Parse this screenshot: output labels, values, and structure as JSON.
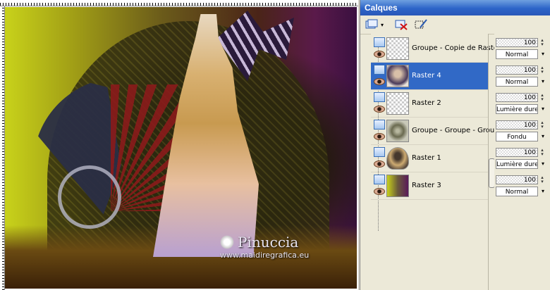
{
  "palette": {
    "title": "Calques"
  },
  "watermark": {
    "signature": "Pinuccia",
    "url": "www.maidiregrafica.eu"
  },
  "layers": [
    {
      "name": "Groupe - Copie de Raster",
      "opacity": "100",
      "blend": "Normal",
      "thumb": "checker",
      "selected": false
    },
    {
      "name": "Raster 4",
      "opacity": "100",
      "blend": "Normal",
      "thumb": "portrait",
      "selected": true
    },
    {
      "name": "Raster 2",
      "opacity": "100",
      "blend": "Lumière dure",
      "thumb": "checker",
      "selected": false
    },
    {
      "name": "Groupe - Groupe - Groupe",
      "opacity": "100",
      "blend": "Fondu",
      "thumb": "group",
      "selected": false
    },
    {
      "name": "Raster 1",
      "opacity": "100",
      "blend": "Lumière dure",
      "thumb": "tunnel",
      "selected": false
    },
    {
      "name": "Raster 3",
      "opacity": "100",
      "blend": "Normal",
      "thumb": "gradient",
      "selected": false
    }
  ],
  "colors": {
    "title_bar": "#2c64c8",
    "selection": "#3169c6"
  }
}
